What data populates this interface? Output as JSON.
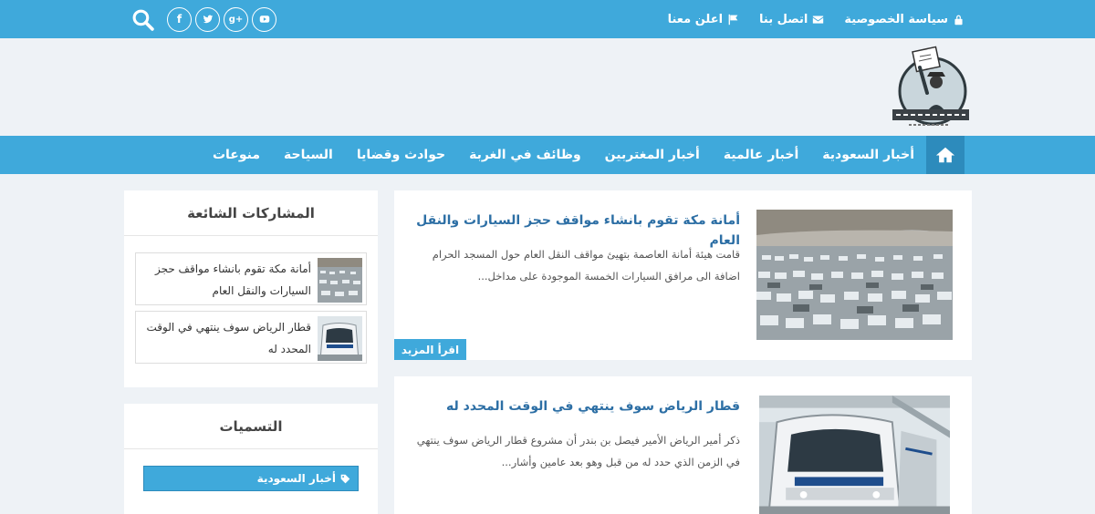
{
  "topbar": {
    "links": [
      {
        "label": "سياسة الخصوصية",
        "icon": "lock-icon"
      },
      {
        "label": "اتصل بنا",
        "icon": "envelope-icon"
      },
      {
        "label": "اعلن معنا",
        "icon": "flag-icon"
      }
    ],
    "social": [
      "facebook-icon",
      "twitter-icon",
      "google-plus-icon",
      "youtube-icon"
    ],
    "social_glyph": {
      "facebook": "f",
      "google_plus": "g+"
    },
    "search_icon": "search-icon"
  },
  "nav": {
    "home_icon": "home-icon",
    "items": [
      "أخبار السعودية",
      "أخبار عالمية",
      "أخبار المغتربين",
      "وظائف في الغربة",
      "حوادث وقضايا",
      "السياحة",
      "منوعات"
    ]
  },
  "posts": [
    {
      "title": "أمانة مكة تقوم بانشاء مواقف حجز السيارات والنقل العام",
      "excerpt": "قامت هيئة أمانة العاصمة بتهيئ مواقف النقل العام حول المسجد الحرام اضافة الى مرافق السيارات الخمسة الموجودة على مداخل...",
      "read_more": "اقرأ المزيد"
    },
    {
      "title": "قطار الرياض سوف ينتهي في الوقت المحدد له",
      "excerpt": "ذكر أمير  الرياض الأمير فيصل بن بندر أن مشروع قطار الرياض سوف ينتهي في الزمن الذي حدد له من قبل وهو بعد عامين وأشار..."
    }
  ],
  "sidebar": {
    "popular_title": "المشاركات الشائعة",
    "popular": [
      {
        "title": "أمانة مكة تقوم بانشاء مواقف حجز السيارات والنقل العام"
      },
      {
        "title": "قطار الرياض سوف ينتهي في الوقت المحدد له"
      }
    ],
    "labels_title": "التسميات",
    "labels": [
      {
        "label": "أخبار السعودية",
        "icon": "tag-icon"
      }
    ]
  },
  "colors": {
    "accent": "#3fa9db",
    "accent_dark": "#2d8bbc",
    "background": "#eef2f6",
    "title_link": "#2d6fa5"
  }
}
